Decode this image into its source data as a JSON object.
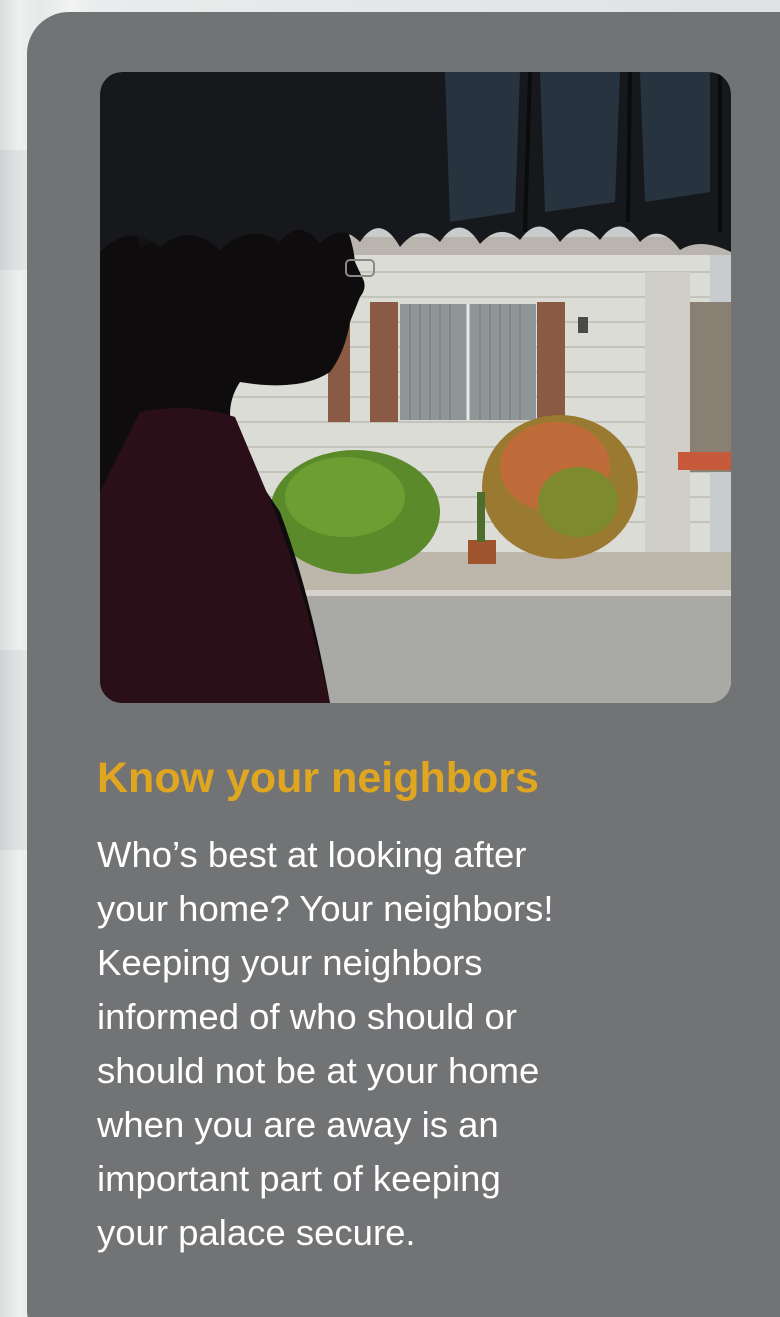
{
  "card": {
    "heading": "Know your neighbors",
    "body_lines": [
      "Who’s best at looking after",
      "your home? Your neighbors!",
      "Keeping your neighbors",
      "informed of who should or",
      "should not be at your home",
      "when you are away is an",
      "important part of keeping",
      "your palace secure."
    ]
  },
  "colors": {
    "card_background": "#727374",
    "heading": "#e0a620",
    "body_text": "#ffffff"
  }
}
